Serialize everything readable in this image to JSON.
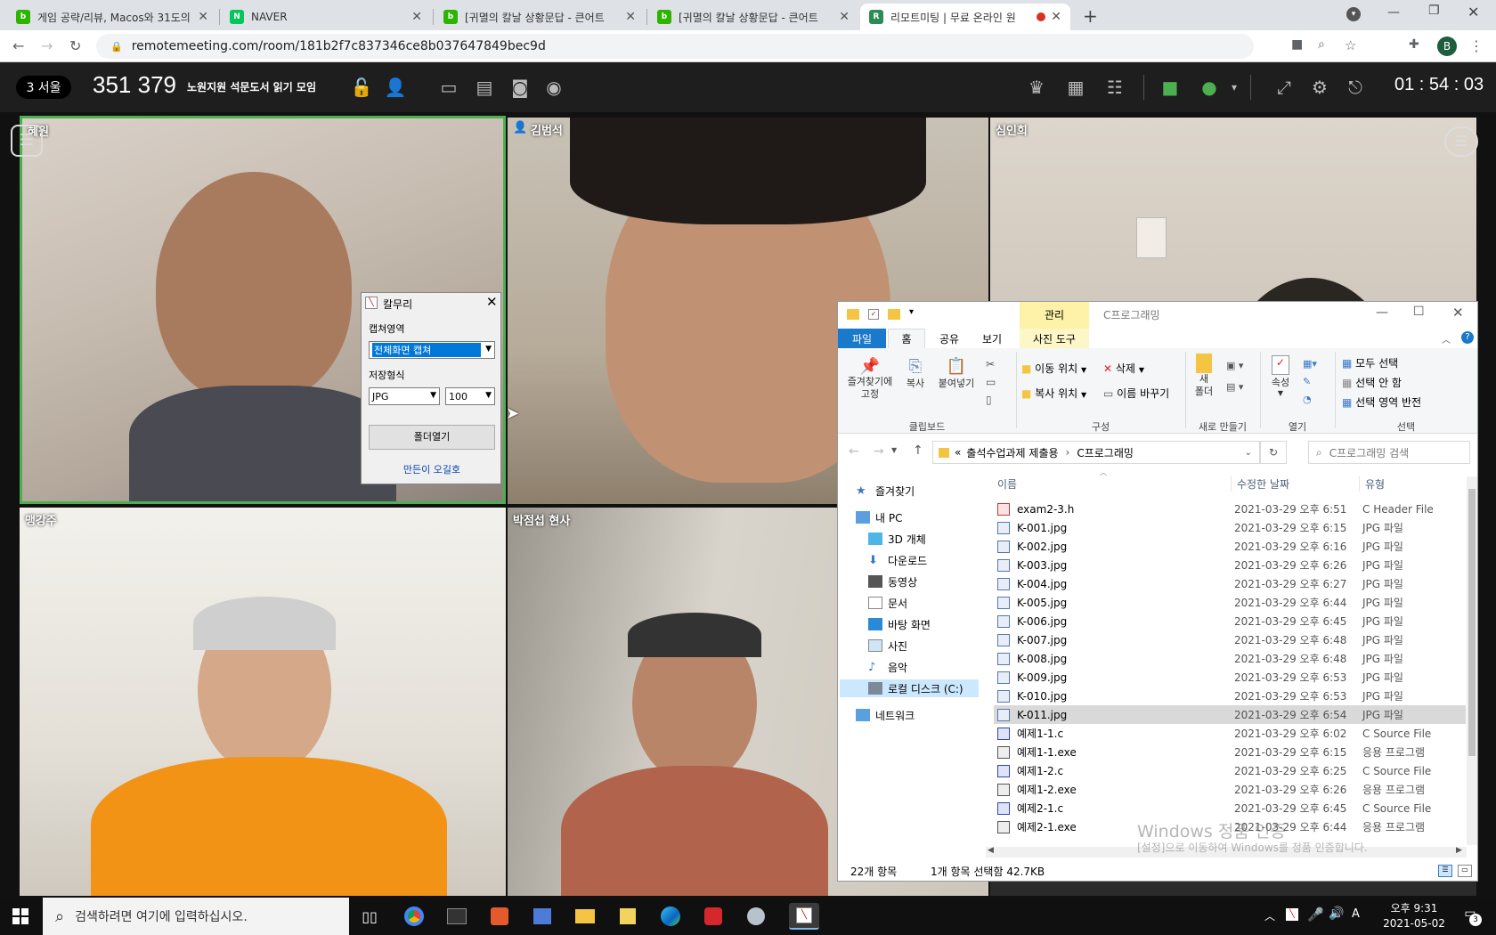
{
  "browser": {
    "tabs": [
      {
        "label": "게임 공략/리뷰, Macos와 31도의",
        "favicon_color": "#2db400",
        "favicon": "blog",
        "active": false
      },
      {
        "label": "NAVER",
        "favicon_color": "#03c75a",
        "favicon": "N",
        "active": false
      },
      {
        "label": "[귀멸의 칼날 상황문답 - 큰어트",
        "favicon_color": "#2db400",
        "favicon": "blog",
        "active": false
      },
      {
        "label": "[귀멸의 칼날 상황문답 - 큰어트",
        "favicon_color": "#2db400",
        "favicon": "blog",
        "active": false
      },
      {
        "label": "리모트미팅 | 무료 온라인 원",
        "favicon_color": "#2e8b57",
        "favicon": "RM",
        "active": true
      }
    ],
    "url": "remotemeeting.com/room/181b2f7c837346ce8b037647849bec9d",
    "profile_initial": "B"
  },
  "meeting": {
    "participant_badge": "3 서울",
    "room_number": "351 379",
    "room_name": "노원지원 석문도서 읽기 모임",
    "timer": "01 : 54 : 03",
    "participants": [
      {
        "name": "혜원",
        "active_speaker": true
      },
      {
        "name": "김범석",
        "host": true
      },
      {
        "name": "심인희"
      },
      {
        "name": "맹강주"
      },
      {
        "name": "박점섭 현사"
      }
    ]
  },
  "capture_dialog": {
    "title": "칼무리",
    "capture_area_label": "캡쳐영역",
    "capture_area_value": "전체화면 캡쳐",
    "save_format_label": "저장형식",
    "format_value": "JPG",
    "quality_value": "100",
    "open_folder_button": "폴더열기",
    "credit_link": "만든이 오길호"
  },
  "explorer": {
    "title": "C프로그래밍",
    "manage_tab": "관리",
    "ribbon_tabs": [
      "파일",
      "홈",
      "공유",
      "보기",
      "사진 도구"
    ],
    "ribbon": {
      "pin": "즐겨찾기에\n고정",
      "copy": "복사",
      "paste": "붙여넣기",
      "move_to": "이동 위치",
      "copy_to": "복사 위치",
      "delete": "삭제",
      "rename": "이름 바꾸기",
      "new_folder": "새\n폴더",
      "properties": "속성",
      "select_all": "모두 선택",
      "select_none": "선택 안 함",
      "invert_selection": "선택 영역 반전",
      "groups": [
        "클립보드",
        "구성",
        "새로 만들기",
        "열기",
        "선택"
      ]
    },
    "breadcrumb": [
      "출석수업과제 제출용",
      "C프로그래밍"
    ],
    "breadcrumb_prefix": "«",
    "search_placeholder": "C프로그래밍 검색",
    "nav_tree": [
      {
        "label": "즐겨찾기",
        "icon": "star-icon",
        "level": 0
      },
      {
        "label": "내 PC",
        "icon": "pc-icon",
        "level": 0
      },
      {
        "label": "3D 개체",
        "icon": "3d-icon",
        "level": 1
      },
      {
        "label": "다운로드",
        "icon": "download-icon",
        "level": 1
      },
      {
        "label": "동영상",
        "icon": "video-icon",
        "level": 1
      },
      {
        "label": "문서",
        "icon": "document-icon",
        "level": 1
      },
      {
        "label": "바탕 화면",
        "icon": "desktop-icon",
        "level": 1
      },
      {
        "label": "사진",
        "icon": "picture-icon",
        "level": 1
      },
      {
        "label": "음악",
        "icon": "music-icon",
        "level": 1
      },
      {
        "label": "로컬 디스크 (C:)",
        "icon": "disk-icon",
        "level": 1,
        "selected": true
      },
      {
        "label": "네트워크",
        "icon": "network-icon",
        "level": 0
      }
    ],
    "columns": [
      "이름",
      "수정한 날짜",
      "유형"
    ],
    "files": [
      {
        "name": "exam2-3.h",
        "date": "2021-03-29 오후 6:51",
        "type": "C Header File"
      },
      {
        "name": "K-001.jpg",
        "date": "2021-03-29 오후 6:15",
        "type": "JPG 파일"
      },
      {
        "name": "K-002.jpg",
        "date": "2021-03-29 오후 6:16",
        "type": "JPG 파일"
      },
      {
        "name": "K-003.jpg",
        "date": "2021-03-29 오후 6:26",
        "type": "JPG 파일"
      },
      {
        "name": "K-004.jpg",
        "date": "2021-03-29 오후 6:27",
        "type": "JPG 파일"
      },
      {
        "name": "K-005.jpg",
        "date": "2021-03-29 오후 6:44",
        "type": "JPG 파일"
      },
      {
        "name": "K-006.jpg",
        "date": "2021-03-29 오후 6:45",
        "type": "JPG 파일"
      },
      {
        "name": "K-007.jpg",
        "date": "2021-03-29 오후 6:48",
        "type": "JPG 파일"
      },
      {
        "name": "K-008.jpg",
        "date": "2021-03-29 오후 6:48",
        "type": "JPG 파일"
      },
      {
        "name": "K-009.jpg",
        "date": "2021-03-29 오후 6:53",
        "type": "JPG 파일"
      },
      {
        "name": "K-010.jpg",
        "date": "2021-03-29 오후 6:53",
        "type": "JPG 파일"
      },
      {
        "name": "K-011.jpg",
        "date": "2021-03-29 오후 6:54",
        "type": "JPG 파일",
        "selected": true
      },
      {
        "name": "예제1-1.c",
        "date": "2021-03-29 오후 6:02",
        "type": "C Source File"
      },
      {
        "name": "예제1-1.exe",
        "date": "2021-03-29 오후 6:15",
        "type": "응용 프로그램"
      },
      {
        "name": "예제1-2.c",
        "date": "2021-03-29 오후 6:25",
        "type": "C Source File"
      },
      {
        "name": "예제1-2.exe",
        "date": "2021-03-29 오후 6:26",
        "type": "응용 프로그램"
      },
      {
        "name": "예제2-1.c",
        "date": "2021-03-29 오후 6:45",
        "type": "C Source File"
      },
      {
        "name": "예제2-1.exe",
        "date": "2021-03-29 오후 6:44",
        "type": "응용 프로그램"
      }
    ],
    "status_count": "22개 항목",
    "status_selected": "1개 항목 선택함 42.7KB",
    "watermark_line1": "Windows 정품 인증",
    "watermark_line2": "[설정]으로 이동하여 Windows를 정품 인증합니다."
  },
  "taskbar": {
    "search_placeholder": "검색하려면 여기에 입력하십시오.",
    "time": "오후 9:31",
    "date": "2021-05-02",
    "notification_count": "3",
    "ime": "A"
  }
}
